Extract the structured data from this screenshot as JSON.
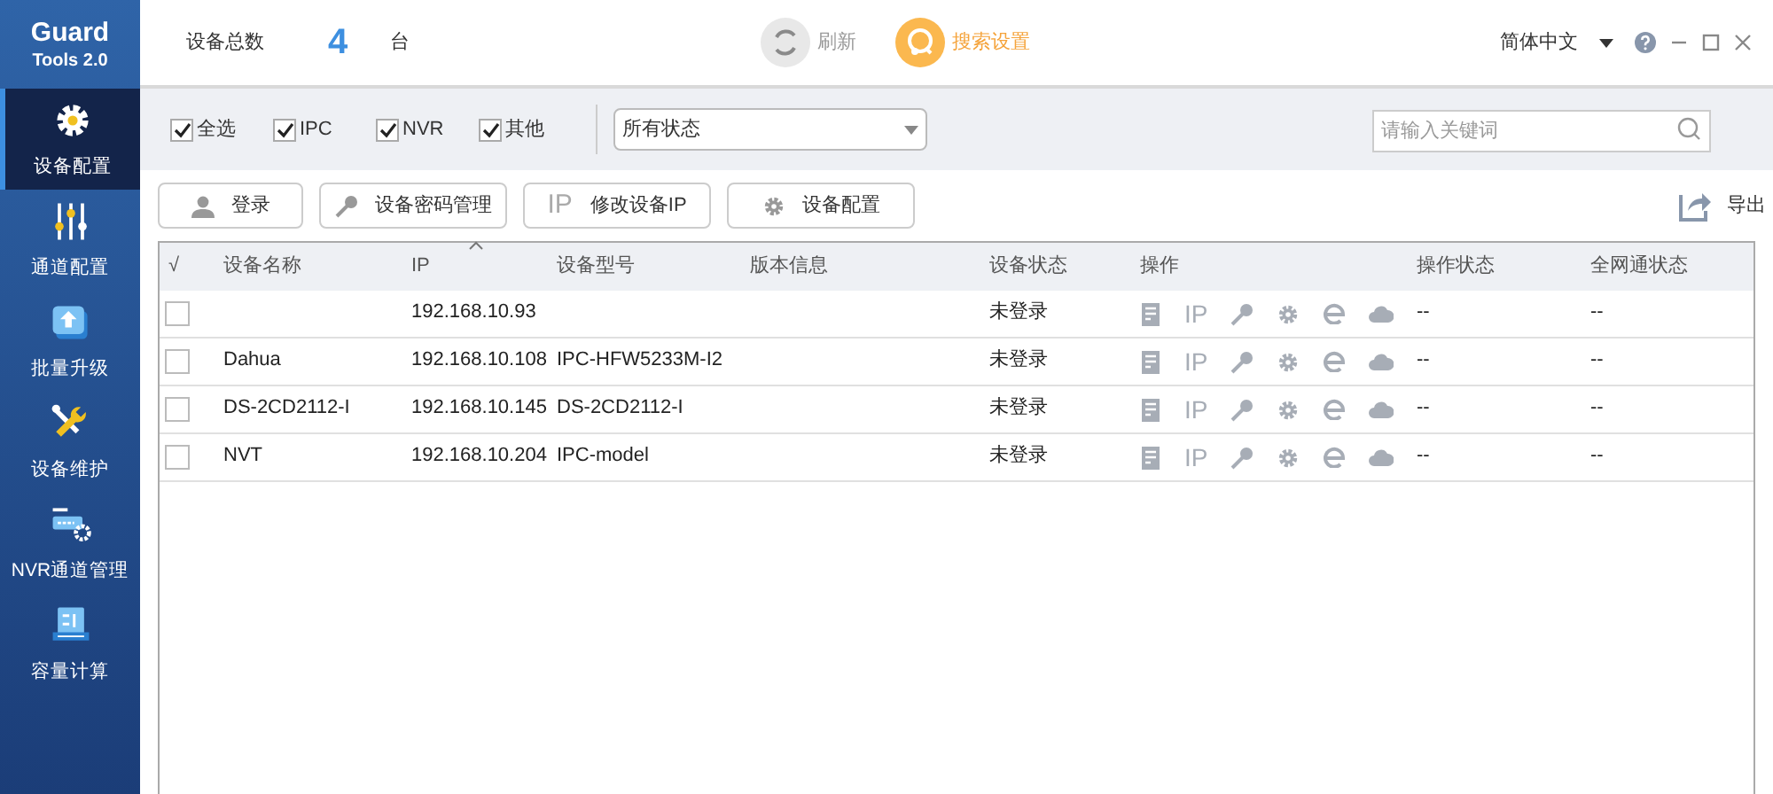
{
  "app": {
    "name": "Guard",
    "subtitle": "Tools 2.0"
  },
  "sidebar": {
    "items": [
      {
        "kind": "gear",
        "label": "设备配置",
        "selected": true
      },
      {
        "kind": "sliders",
        "label": "通道配置",
        "selected": false
      },
      {
        "kind": "upgrade",
        "label": "批量升级",
        "selected": false
      },
      {
        "kind": "tools",
        "label": "设备维护",
        "selected": false
      },
      {
        "kind": "nvr",
        "label": "NVR通道管理",
        "selected": false
      },
      {
        "kind": "disk",
        "label": "容量计算",
        "selected": false
      }
    ]
  },
  "header": {
    "count_label": "设备总数",
    "count": "4",
    "unit": "台",
    "refresh": "刷新",
    "search_settings": "搜索设置",
    "language": "简体中文"
  },
  "filters": [
    {
      "label": "全选",
      "checked": true
    },
    {
      "label": "IPC",
      "checked": true
    },
    {
      "label": "NVR",
      "checked": true
    },
    {
      "label": "其他",
      "checked": true
    }
  ],
  "status_select": {
    "value": "所有状态"
  },
  "search": {
    "placeholder": "请输入关键词"
  },
  "actions": [
    {
      "kind": "user",
      "label": "登录"
    },
    {
      "kind": "key",
      "label": "设备密码管理"
    },
    {
      "kind": "ip",
      "icon_text": "IP",
      "label": "修改设备IP"
    },
    {
      "kind": "gear",
      "label": "设备配置"
    }
  ],
  "export": "导出",
  "table": {
    "columns": [
      "√",
      "设备名称",
      "IP",
      "设备型号",
      "版本信息",
      "设备状态",
      "操作",
      "操作状态",
      "全网通状态"
    ],
    "rows": [
      {
        "checked": false,
        "name": "",
        "ip": "192.168.10.93",
        "model": "",
        "version": "",
        "status": "未登录",
        "ops_ip": "IP",
        "op_status": "--",
        "net_status": "--"
      },
      {
        "checked": false,
        "name": "Dahua",
        "ip": "192.168.10.108",
        "model": "IPC-HFW5233M-I2",
        "version": "",
        "status": "未登录",
        "ops_ip": "IP",
        "op_status": "--",
        "net_status": "--"
      },
      {
        "checked": false,
        "name": "DS-2CD2112-I",
        "ip": "192.168.10.145",
        "model": "DS-2CD2112-I",
        "version": "",
        "status": "未登录",
        "ops_ip": "IP",
        "op_status": "--",
        "net_status": "--"
      },
      {
        "checked": false,
        "name": "NVT",
        "ip": "192.168.10.204",
        "model": "IPC-model",
        "version": "",
        "status": "未登录",
        "ops_ip": "IP",
        "op_status": "--",
        "net_status": "--"
      }
    ]
  }
}
